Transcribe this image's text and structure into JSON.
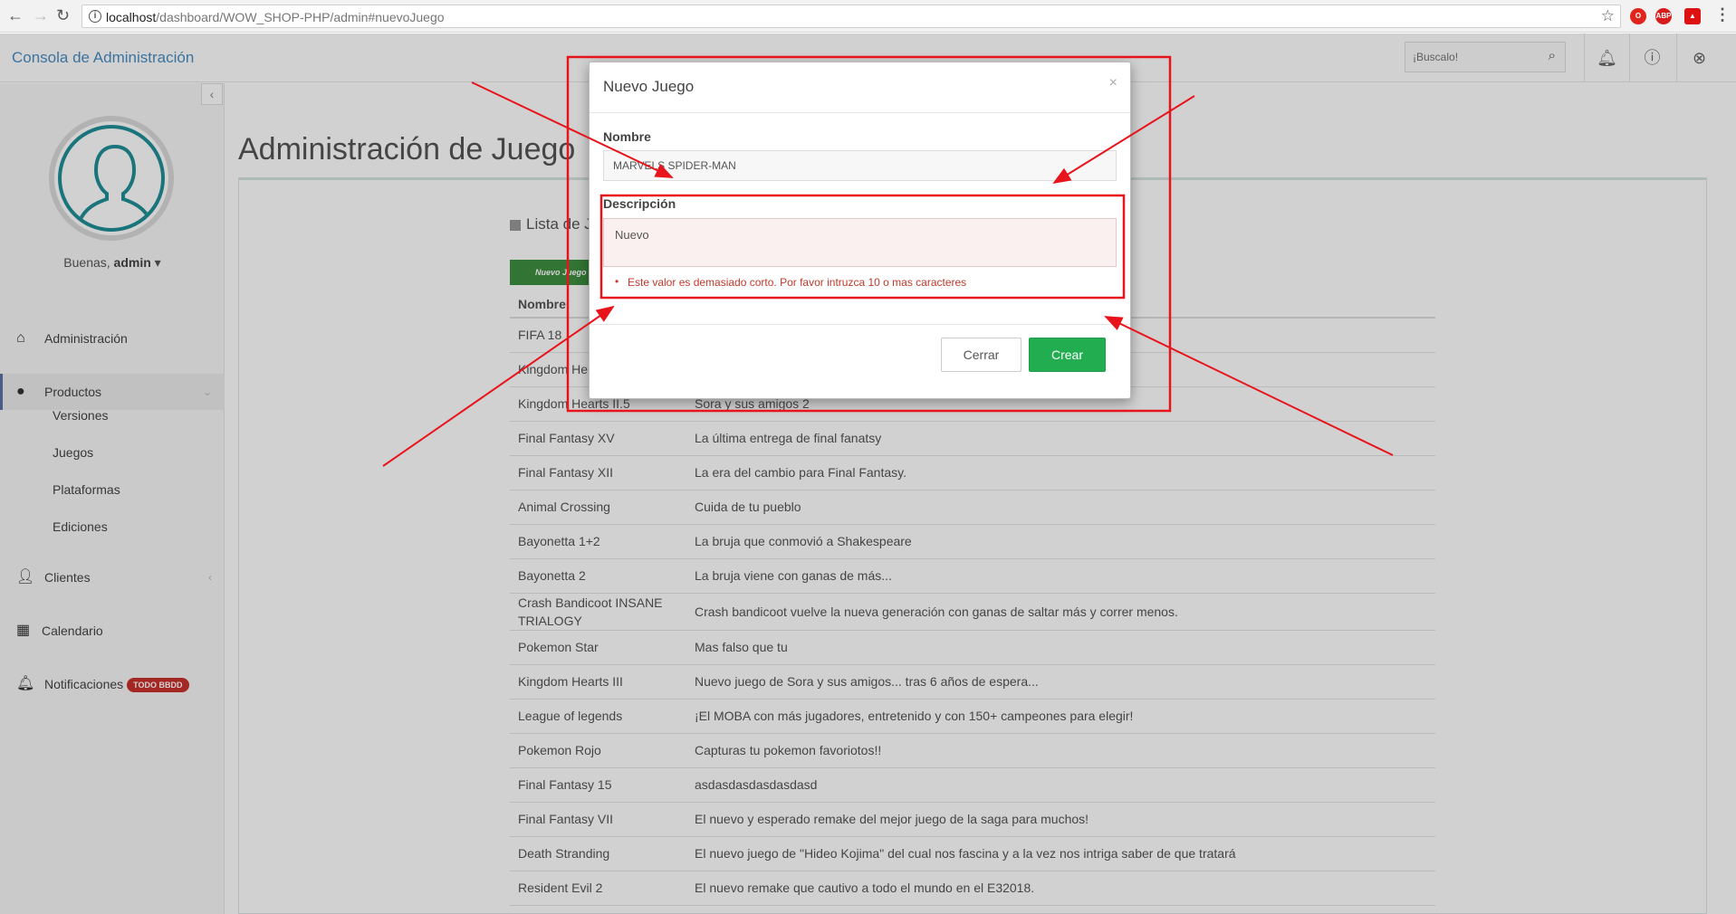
{
  "browser": {
    "url_host": "localhost",
    "url_path": "/dashboard/WOW_SHOP-PHP/admin#nuevoJuego",
    "extensions": [
      "opera-icon",
      "adblock-icon",
      "pdf-icon"
    ],
    "ext_abp_label": "ABP"
  },
  "header": {
    "brand": "Consola de Administración",
    "search_placeholder": "¡Buscalo!"
  },
  "sidebar": {
    "greeting_prefix": "Buenas,",
    "user": "admin",
    "items": [
      {
        "label": "Administración"
      },
      {
        "label": "Productos"
      },
      {
        "label": "Clientes"
      },
      {
        "label": "Calendario"
      },
      {
        "label": "Notificaciones",
        "badge": "TODO BBDD"
      }
    ],
    "subitems": [
      "Versiones",
      "Juegos",
      "Plataformas",
      "Ediciones"
    ]
  },
  "main": {
    "page_title": "Administración de Juego",
    "list_title": "Lista de J",
    "new_button": "Nuevo Juego",
    "columns": [
      "Nombre",
      ""
    ],
    "rows": [
      {
        "name": "FIFA 18",
        "desc": ""
      },
      {
        "name": "Kingdom He",
        "desc": ""
      },
      {
        "name": "Kingdom Hearts II.5",
        "desc": "Sora y sus amigos 2"
      },
      {
        "name": "Final Fantasy XV",
        "desc": "La última entrega de final fanatsy"
      },
      {
        "name": "Final Fantasy XII",
        "desc": "La era del cambio para Final Fantasy."
      },
      {
        "name": "Animal Crossing",
        "desc": "Cuida de tu pueblo"
      },
      {
        "name": "Bayonetta 1+2",
        "desc": "La bruja que conmovió a Shakespeare"
      },
      {
        "name": "Bayonetta 2",
        "desc": "La bruja viene con ganas de más..."
      },
      {
        "name": "Crash Bandicoot INSANE TRIALOGY",
        "desc": "Crash bandicoot vuelve la nueva generación con ganas de saltar más y correr menos."
      },
      {
        "name": "Pokemon Star",
        "desc": "Mas falso que tu"
      },
      {
        "name": "Kingdom Hearts III",
        "desc": "Nuevo juego de Sora y sus amigos... tras 6 años de espera..."
      },
      {
        "name": "League of legends",
        "desc": "¡El MOBA con más jugadores, entretenido y con 150+ campeones para elegir!"
      },
      {
        "name": "Pokemon Rojo",
        "desc": "Capturas tu pokemon favoriotos!!"
      },
      {
        "name": "Final Fantasy 15",
        "desc": "asdasdasdasdasdasd"
      },
      {
        "name": "Final Fantasy VII",
        "desc": "El nuevo y esperado remake del mejor juego de la saga para muchos!"
      },
      {
        "name": "Death Stranding",
        "desc": "El nuevo juego de \"Hideo Kojima\" del cual nos fascina y a la vez nos intriga saber de que tratará"
      },
      {
        "name": "Resident Evil 2",
        "desc": "El nuevo remake que cautivo a todo el mundo en el E32018."
      }
    ]
  },
  "modal": {
    "title": "Nuevo Juego",
    "close_glyph": "×",
    "nombre_label": "Nombre",
    "nombre_value": "MARVELS SPIDER-MAN",
    "descripcion_label": "Descripción",
    "descripcion_value": "Nuevo",
    "error": "Este valor es demasiado corto. Por favor intruzca 10 o mas caracteres",
    "cerrar": "Cerrar",
    "crear": "Crear"
  },
  "colors": {
    "annotation": "#e8141b",
    "crear": "#22ad50",
    "brand": "#4a8ec2",
    "badge": "#c9302c"
  }
}
